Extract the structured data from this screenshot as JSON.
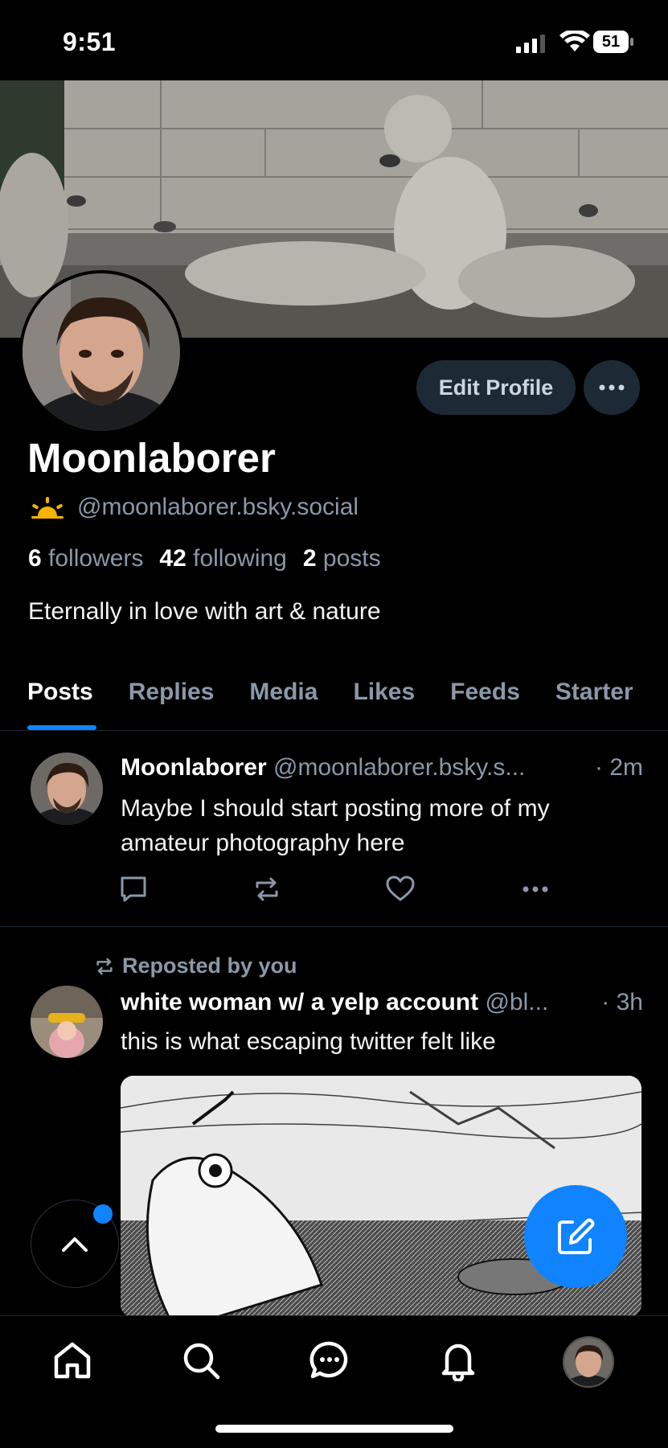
{
  "status_bar": {
    "time": "9:51",
    "battery": "51"
  },
  "profile": {
    "display_name": "Moonlaborer",
    "handle": "@moonlaborer.bsky.social",
    "stats": {
      "followers_count": "6",
      "followers_label": "followers",
      "following_count": "42",
      "following_label": "following",
      "posts_count": "2",
      "posts_label": "posts"
    },
    "bio": "Eternally in love with art & nature",
    "edit_button_label": "Edit Profile"
  },
  "tabs": [
    {
      "label": "Posts"
    },
    {
      "label": "Replies"
    },
    {
      "label": "Media"
    },
    {
      "label": "Likes"
    },
    {
      "label": "Feeds"
    },
    {
      "label": "Starter"
    }
  ],
  "posts": [
    {
      "author": "Moonlaborer",
      "handle": "@moonlaborer.bsky.s...",
      "time": "· 2m",
      "text": "Maybe I should start posting more of my amateur photography here"
    },
    {
      "repost_label": "Reposted by you",
      "author": "white woman w/ a yelp account",
      "handle": "@bl...",
      "time": "· 3h",
      "text": "this is what escaping twitter felt like"
    }
  ],
  "colors": {
    "accent": "#1083fe",
    "muted": "#8a98a8",
    "button_bg": "#1e2936"
  },
  "icons": {
    "nav": [
      "home-icon",
      "search-icon",
      "chat-icon",
      "bell-icon",
      "profile-avatar"
    ],
    "post_actions": [
      "reply-icon",
      "repost-icon",
      "like-icon",
      "more-icon"
    ]
  }
}
